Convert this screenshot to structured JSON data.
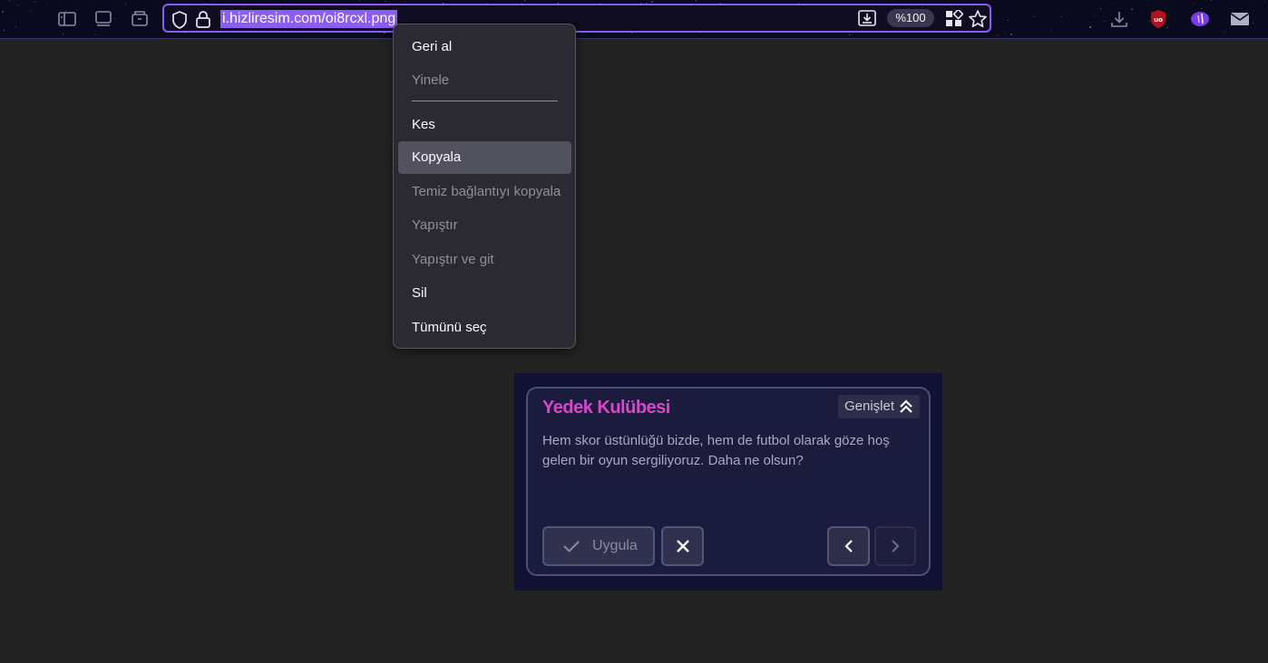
{
  "browser": {
    "url": "i.hizliresim.com/oi8rcxl.png",
    "zoom": "%100",
    "accent_color": "#8b5cf6",
    "toolbar_icons": [
      "sidebar-icon",
      "tab-overview-icon",
      "container-icon",
      "shield-icon",
      "lock-icon",
      "page-download-icon",
      "grid-icon",
      "bookmark-star-icon",
      "downloads-icon",
      "ublock-icon",
      "extension-icon",
      "mail-icon"
    ]
  },
  "context_menu": {
    "items": [
      {
        "label": "Geri al",
        "enabled": true
      },
      {
        "label": "Yinele",
        "enabled": false
      },
      {
        "label": "Kes",
        "enabled": true
      },
      {
        "label": "Kopyala",
        "enabled": true,
        "highlighted": true
      },
      {
        "label": "Temiz bağlantıyı kopyala",
        "enabled": false
      },
      {
        "label": "Yapıştır",
        "enabled": false
      },
      {
        "label": "Yapıştır ve git",
        "enabled": false
      },
      {
        "label": "Sil",
        "enabled": true
      },
      {
        "label": "Tümünü seç",
        "enabled": true
      }
    ]
  },
  "image_content": {
    "title": "Yedek Kulübesi",
    "title_color": "#d946c9",
    "expand_label": "Genişlet",
    "message": "Hem skor üstünlüğü bizde, hem de futbol olarak göze hoş gelen bir oyun sergiliyoruz. Daha ne olsun?",
    "apply_label": "Uygula"
  }
}
